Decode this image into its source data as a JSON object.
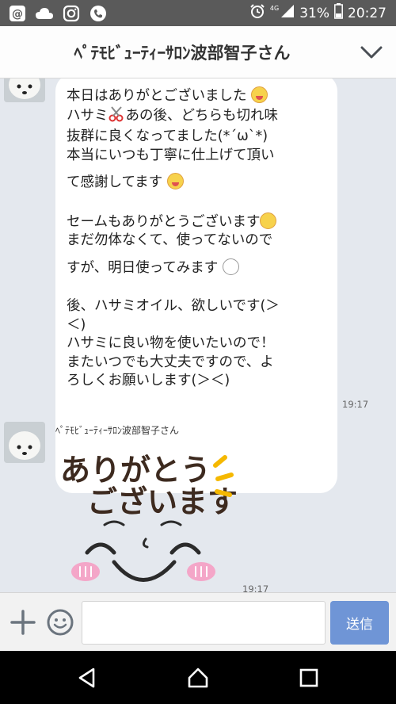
{
  "status_bar": {
    "network": "4G",
    "battery": "31%",
    "time": "20:27",
    "icons": [
      "at-icon",
      "cloud-icon",
      "instagram-icon",
      "phone-icon",
      "alarm-icon",
      "signal-icon",
      "battery-icon"
    ]
  },
  "header": {
    "title": "ﾍﾟﾃﾓﾋﾞｭｰﾃｨｰｻﾛﾝ波部智子さん"
  },
  "messages": [
    {
      "lines": [
        "本日はありがとございました",
        "ハサミ",
        "あの後、どちらも切れ味",
        "抜群に良くなってました(*´ω`*)",
        "本当にいつも丁寧に仕上げて頂い",
        "て感謝してます",
        "セームもありがとうございます",
        "まだ勿体なくて、使ってないので",
        "すが、明日使ってみます",
        "後、ハサミオイル、欲しいです(＞",
        "＜)",
        "ハサミに良い物を使いたいので！",
        "またいつでも大丈夫ですので、よ",
        "ろしくお願いします(＞＜)"
      ],
      "time": "19:17"
    },
    {
      "sender": "ﾍﾟﾃﾓﾋﾞｭｰﾃｨｰｻﾛﾝ波部智子さん",
      "sticker_text_1": "ありがとう",
      "sticker_text_2": "ございます",
      "time": "19:17"
    }
  ],
  "input": {
    "placeholder": "",
    "send_label": "送信"
  },
  "colors": {
    "chat_bg": "#e4e8ee",
    "send_button": "#6f95d6",
    "status_bar": "#5a5a5a",
    "sticker_text": "#3d2a1f",
    "sticker_accent": "#f5b800",
    "sticker_cheek": "#f4a6c8"
  }
}
